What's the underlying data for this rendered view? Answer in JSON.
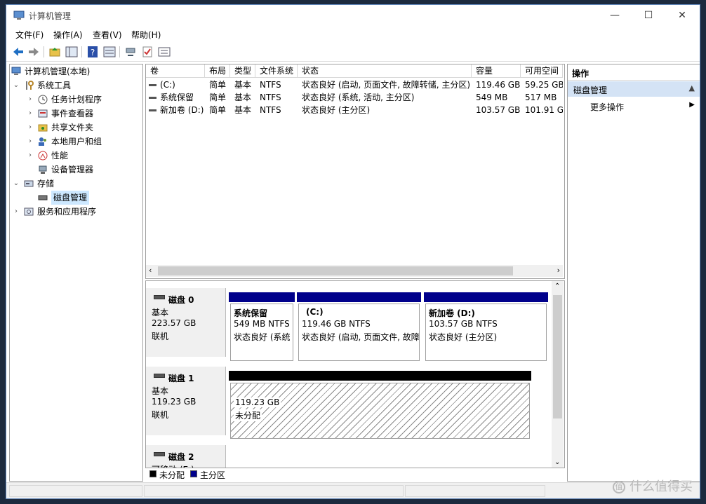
{
  "window": {
    "title": "计算机管理",
    "controls": {
      "minimize": "—",
      "maximize": "☐",
      "close": "✕"
    }
  },
  "menu": [
    "文件(F)",
    "操作(A)",
    "查看(V)",
    "帮助(H)"
  ],
  "toolbar_icons": [
    "back-arrow-icon",
    "forward-arrow-icon",
    "up-folder-icon",
    "show-hide-tree-icon",
    "help-icon",
    "properties-icon",
    "connect-icon",
    "check-icon",
    "list-icon"
  ],
  "tree": {
    "root": "计算机管理(本地)",
    "system_tools": "系统工具",
    "task_scheduler": "任务计划程序",
    "event_viewer": "事件查看器",
    "shared_folders": "共享文件夹",
    "local_users": "本地用户和组",
    "performance": "性能",
    "device_manager": "设备管理器",
    "storage": "存储",
    "disk_management": "磁盘管理",
    "services_apps": "服务和应用程序"
  },
  "volume_list": {
    "columns": [
      "卷",
      "布局",
      "类型",
      "文件系统",
      "状态",
      "容量",
      "可用空间"
    ],
    "rows": [
      {
        "volume": "(C:)",
        "layout": "简单",
        "type": "基本",
        "fs": "NTFS",
        "status": "状态良好 (启动, 页面文件, 故障转储, 主分区)",
        "capacity": "119.46 GB",
        "free": "59.25 GB"
      },
      {
        "volume": "系统保留",
        "layout": "简单",
        "type": "基本",
        "fs": "NTFS",
        "status": "状态良好 (系统, 活动, 主分区)",
        "capacity": "549 MB",
        "free": "517 MB"
      },
      {
        "volume": "新加卷 (D:)",
        "layout": "简单",
        "type": "基本",
        "fs": "NTFS",
        "status": "状态良好 (主分区)",
        "capacity": "103.57 GB",
        "free": "101.91 G"
      }
    ]
  },
  "disks": [
    {
      "name": "磁盘 0",
      "type": "基本",
      "size": "223.57 GB",
      "status": "联机",
      "partitions": [
        {
          "name": "系统保留",
          "size": "549 MB NTFS",
          "status": "状态良好 (系统"
        },
        {
          "name": "(C:)",
          "size": "119.46 GB NTFS",
          "status": "状态良好 (启动, 页面文件, 故障"
        },
        {
          "name": "新加卷 (D:)",
          "size": "103.57 GB NTFS",
          "status": "状态良好 (主分区)"
        }
      ]
    },
    {
      "name": "磁盘 1",
      "type": "基本",
      "size": "119.23 GB",
      "status": "联机",
      "partitions": [
        {
          "name": "",
          "size": "119.23 GB",
          "status": "未分配"
        }
      ]
    },
    {
      "name": "磁盘 2",
      "type": "可移动 (E:)"
    }
  ],
  "legend": {
    "unallocated": "未分配",
    "primary": "主分区"
  },
  "actions": {
    "header": "操作",
    "section": "磁盘管理",
    "more": "更多操作"
  },
  "colors": {
    "primary_partition": "#00008b",
    "unallocated": "#000000",
    "selection": "#cde8ff",
    "actions_section": "#d4e3f5"
  },
  "watermark": "什么值得买"
}
